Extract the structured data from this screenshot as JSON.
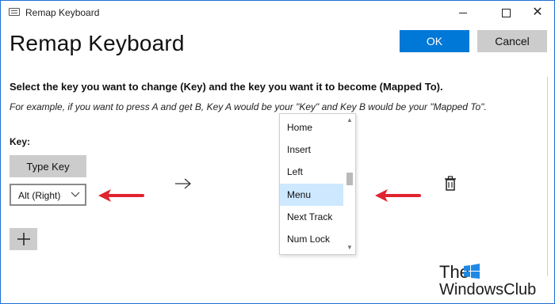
{
  "window": {
    "title": "Remap Keyboard"
  },
  "header": {
    "title": "Remap Keyboard",
    "ok_label": "OK",
    "cancel_label": "Cancel"
  },
  "instructions": {
    "main": "Select the key you want to change (Key) and the key you want it to become (Mapped To).",
    "example": "For example, if you want to press A and get B, Key A would be your \"Key\" and Key B would be your \"Mapped To\"."
  },
  "key_section": {
    "label": "Key:",
    "type_key_label": "Type Key",
    "selected_key": "Alt (Right)"
  },
  "mapped_to": {
    "items": [
      "Home",
      "Insert",
      "Left",
      "Menu",
      "Next Track",
      "Num Lock"
    ],
    "selected": "Menu"
  },
  "watermark": {
    "line1": "The",
    "line2": "WindowsClub"
  },
  "colors": {
    "accent": "#0078d7",
    "annotation_arrow": "#e0232e",
    "selected_item": "#cde8ff",
    "button_gray": "#cccccc"
  },
  "icons": {
    "window": "keyboard-icon",
    "arrow": "right-arrow-icon",
    "delete": "trash-icon",
    "add": "plus-icon",
    "dropdown": "chevron-down-icon"
  }
}
